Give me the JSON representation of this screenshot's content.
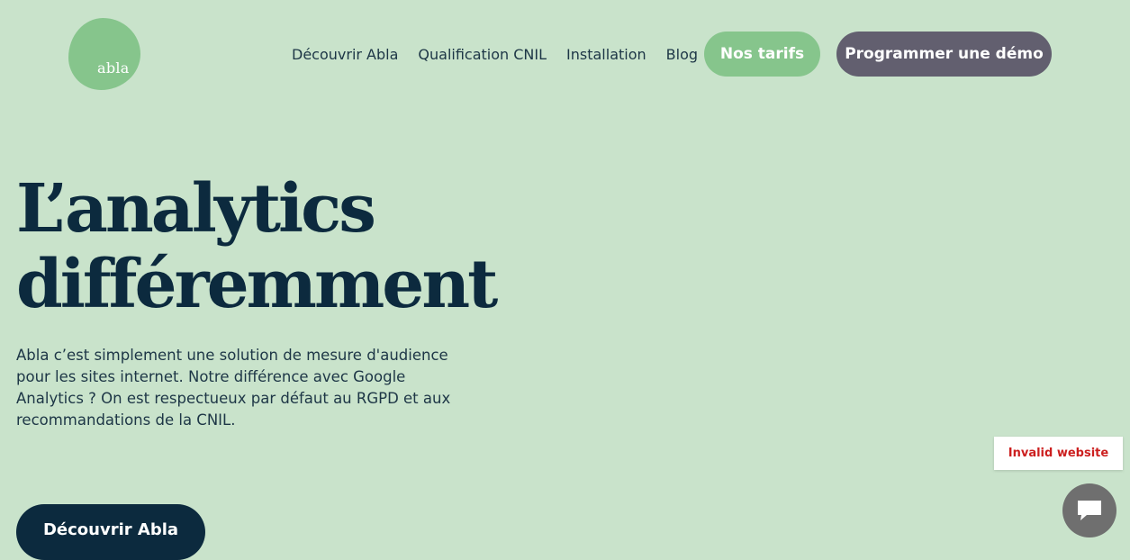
{
  "logo": {
    "text": "abla",
    "color": "#86c58c"
  },
  "nav": {
    "links": [
      "Découvrir Abla",
      "Qualification CNIL",
      "Installation",
      "Blog"
    ],
    "pricing_label": "Nos tarifs",
    "demo_label": "Programmer une démo"
  },
  "hero": {
    "title_line1": "L’analytics",
    "title_line2": "différemment",
    "description": "Abla c’est simplement une solution de mesure d'audience pour les sites internet. Notre différence avec Google Analytics ? On est respectueux par défaut au RGPD et aux recommandations de la CNIL.",
    "cta_label": "Découvrir Abla"
  },
  "badge": {
    "text": "Invalid website"
  },
  "chat": {
    "icon": "chat-bubble-icon"
  },
  "colors": {
    "background": "#c9e3cb",
    "accent_green": "#86c58c",
    "demo_button": "#625f6f",
    "dark_navy": "#0c2a3e",
    "error_red": "#cc1f1f"
  }
}
